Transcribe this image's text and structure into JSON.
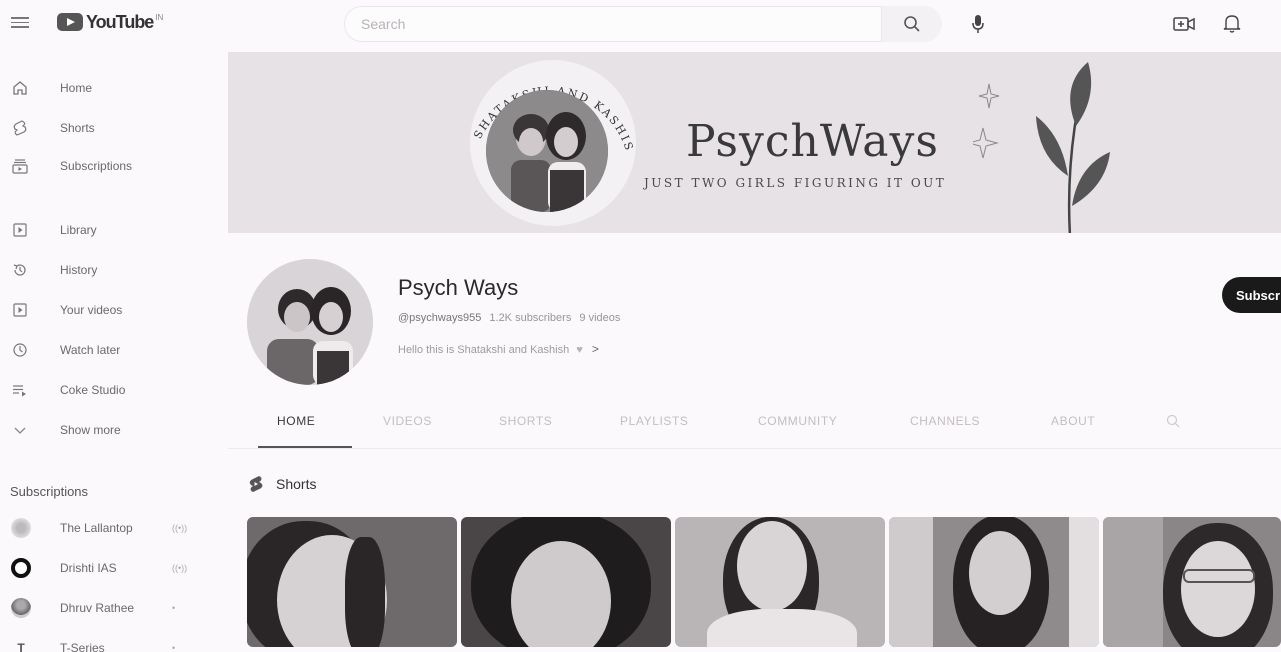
{
  "app": {
    "logo_text": "YouTube",
    "logo_sup": "IN"
  },
  "search": {
    "placeholder": "Search"
  },
  "sidebar": {
    "main": [
      {
        "label": "Home",
        "icon": "home-icon"
      },
      {
        "label": "Shorts",
        "icon": "shorts-icon"
      },
      {
        "label": "Subscriptions",
        "icon": "subscriptions-icon"
      }
    ],
    "library": [
      {
        "label": "Library",
        "icon": "library-icon"
      },
      {
        "label": "History",
        "icon": "history-icon"
      },
      {
        "label": "Your videos",
        "icon": "your-videos-icon"
      },
      {
        "label": "Watch later",
        "icon": "clock-icon"
      },
      {
        "label": "Coke Studio",
        "icon": "playlist-icon"
      },
      {
        "label": "Show more",
        "icon": "chevron-down-icon"
      }
    ],
    "subscriptions_title": "Subscriptions",
    "subscriptions": [
      {
        "label": "The Lallantop",
        "badge": "live"
      },
      {
        "label": "Drishti IAS",
        "badge": "live"
      },
      {
        "label": "Dhruv Rathee",
        "badge": "dot"
      },
      {
        "label": "T-Series",
        "badge": "dot"
      }
    ]
  },
  "banner": {
    "arc_text": "SHATAKSHI AND KASHISH",
    "title": "PsychWays",
    "tagline": "JUST TWO GIRLS FIGURING IT OUT"
  },
  "channel": {
    "name": "Psych Ways",
    "handle": "@psychways955",
    "subscribers": "1.2K subscribers",
    "videos": "9 videos",
    "description": "Hello this is Shatakshi and Kashish",
    "subscribe_label": "Subscribe"
  },
  "tabs": [
    {
      "label": "HOME",
      "active": true
    },
    {
      "label": "VIDEOS",
      "active": false
    },
    {
      "label": "SHORTS",
      "active": false
    },
    {
      "label": "PLAYLISTS",
      "active": false
    },
    {
      "label": "COMMUNITY",
      "active": false
    },
    {
      "label": "CHANNELS",
      "active": false
    },
    {
      "label": "ABOUT",
      "active": false
    }
  ],
  "shorts_section": {
    "title": "Shorts"
  },
  "colors": {
    "accent": "#1a1a1a",
    "background": "#fbf9fb",
    "banner": "#e6e2e6"
  }
}
